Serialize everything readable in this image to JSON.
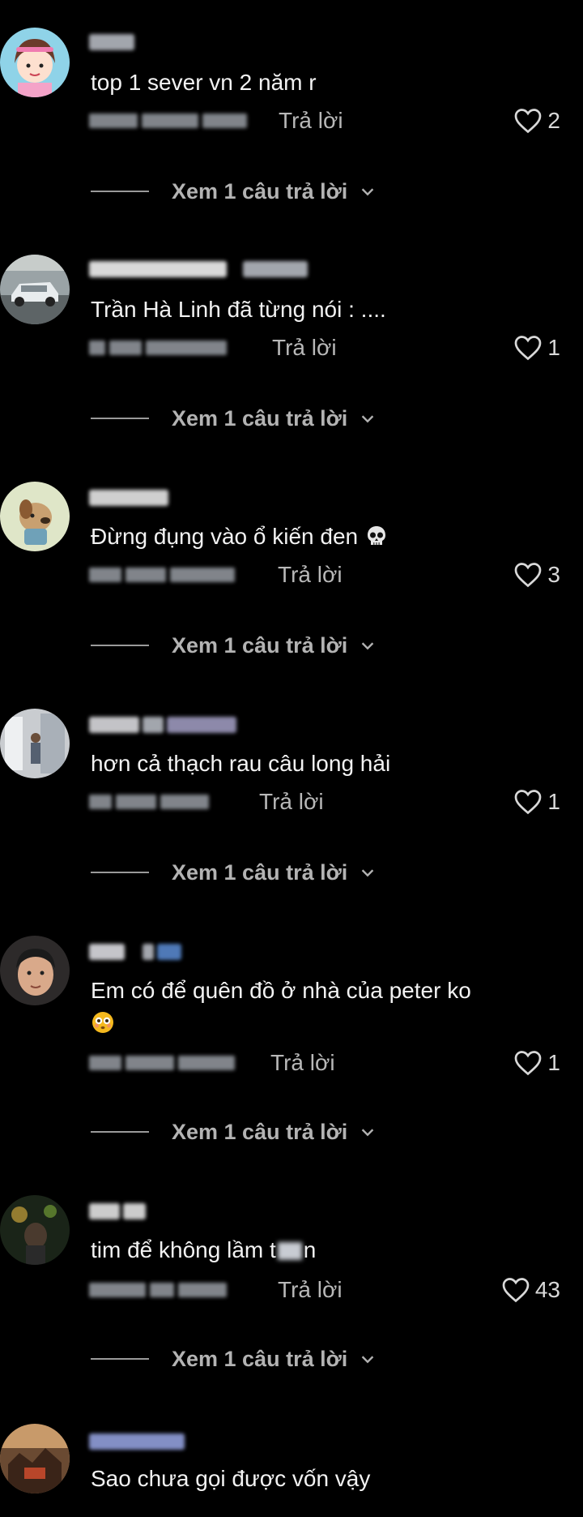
{
  "comments": [
    {
      "text": "top 1 sever vn 2 năm r",
      "reply_label": "Trả lời",
      "likes": "2",
      "view_replies": "Xem 1 câu trả lời"
    },
    {
      "text": "Trần Hà Linh đã từng nói : ....",
      "reply_label": "Trả lời",
      "likes": "1",
      "view_replies": "Xem 1 câu trả lời"
    },
    {
      "text": "Đừng đụng vào ổ kiến đen",
      "emoji": "skull",
      "reply_label": "Trả lời",
      "likes": "3",
      "view_replies": "Xem 1 câu trả lời"
    },
    {
      "text": "hơn cả thạch rau câu long hải",
      "reply_label": "Trả lời",
      "likes": "1",
      "view_replies": "Xem 1 câu trả lời"
    },
    {
      "text": "Em có để quên đồ ở nhà của peter ko",
      "emoji": "flushed-face",
      "reply_label": "Trả lời",
      "likes": "1",
      "view_replies": "Xem 1 câu trả lời"
    },
    {
      "text_before": "tim để không lầm t",
      "text_after": "n",
      "reply_label": "Trả lời",
      "likes": "43",
      "view_replies": "Xem 1 câu trả lời"
    },
    {
      "text": "Sao chưa gọi được vốn vậy"
    }
  ],
  "colors": {
    "background": "#000000",
    "text": "#f2f2f2",
    "secondary": "#b8b8b8"
  }
}
